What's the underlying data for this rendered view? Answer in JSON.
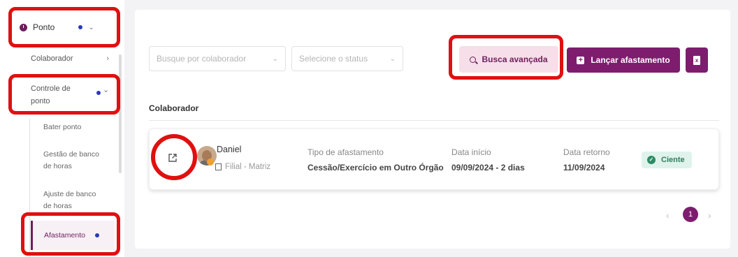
{
  "sidebar": {
    "module": {
      "label": "Ponto",
      "icon": "clock-icon"
    },
    "items": [
      {
        "label": "Colaborador",
        "chevron": "›"
      },
      {
        "label": "Controle de ponto",
        "chevron": "⌄"
      }
    ],
    "sub_items": [
      {
        "label": "Bater ponto"
      },
      {
        "label": "Gestão de banco de horas"
      },
      {
        "label": "Ajuste de banco de horas"
      },
      {
        "label": "Afastamento",
        "active": true
      }
    ]
  },
  "filters": {
    "collaborator_placeholder": "Busque por colaborador",
    "status_placeholder": "Selecione o status"
  },
  "actions": {
    "advanced_search_label": "Busca avançada",
    "launch_leave_label": "Lançar afastamento",
    "export_icon": "excel-icon",
    "export_glyph": "x"
  },
  "table": {
    "column_header": "Colaborador",
    "rows": [
      {
        "name": "Daniel",
        "branch": "Filial - Matriz",
        "leave_type_label": "Tipo de afastamento",
        "leave_type_value": "Cessão/Exercício em Outro Órgão",
        "start_label": "Data início",
        "start_value": "09/09/2024 - 2 dias",
        "return_label": "Data retorno",
        "return_value": "11/09/2024",
        "status": "Ciente"
      }
    ]
  },
  "pagination": {
    "current_page": "1",
    "prev": "‹",
    "next": "›"
  },
  "colors": {
    "brand": "#7e1d6e",
    "highlight": "#e01010",
    "status_ok": "#2e8b66",
    "indicator_dot": "#2b3ab8"
  }
}
